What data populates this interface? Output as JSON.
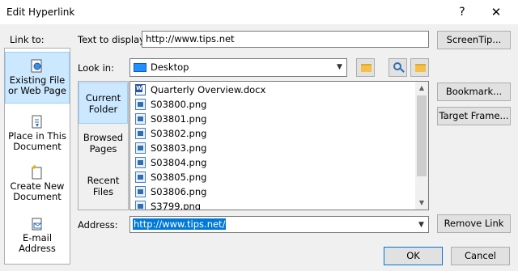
{
  "window": {
    "title": "Edit Hyperlink",
    "help_glyph": "?",
    "close_glyph": "✕"
  },
  "link_to": {
    "label": "Link to:",
    "items": [
      {
        "label_line1": "Existing File",
        "label_line2": "or Web Page",
        "icon": "web-page-icon",
        "selected": true
      },
      {
        "label_line1": "Place in This",
        "label_line2": "Document",
        "icon": "document-place-icon",
        "selected": false
      },
      {
        "label_line1": "Create New",
        "label_line2": "Document",
        "icon": "new-document-icon",
        "selected": false
      },
      {
        "label_line1": "E-mail",
        "label_line2": "Address",
        "icon": "email-icon",
        "selected": false
      }
    ]
  },
  "text_to_display": {
    "label": "Text to display:",
    "value": "http://www.tips.net"
  },
  "screentip_button": "ScreenTip...",
  "look_in": {
    "label": "Look in:",
    "value": "Desktop"
  },
  "side_tabs": [
    {
      "line1": "Current",
      "line2": "Folder",
      "selected": true
    },
    {
      "line1": "Browsed",
      "line2": "Pages",
      "selected": false
    },
    {
      "line1": "Recent",
      "line2": "Files",
      "selected": false
    }
  ],
  "files": [
    {
      "name": "Quarterly Overview.docx",
      "type": "word"
    },
    {
      "name": "S03800.png",
      "type": "image"
    },
    {
      "name": "S03801.png",
      "type": "image"
    },
    {
      "name": "S03802.png",
      "type": "image"
    },
    {
      "name": "S03803.png",
      "type": "image"
    },
    {
      "name": "S03804.png",
      "type": "image"
    },
    {
      "name": "S03805.png",
      "type": "image"
    },
    {
      "name": "S03806.png",
      "type": "image"
    },
    {
      "name": "S3799.png",
      "type": "image"
    }
  ],
  "right_buttons": {
    "bookmark": "Bookmark...",
    "target_frame": "Target Frame...",
    "remove_link": "Remove Link"
  },
  "address": {
    "label": "Address:",
    "value": "http://www.tips.net/"
  },
  "footer": {
    "ok": "OK",
    "cancel": "Cancel"
  },
  "colors": {
    "selection": "#cce8ff",
    "accent": "#0078d7"
  }
}
